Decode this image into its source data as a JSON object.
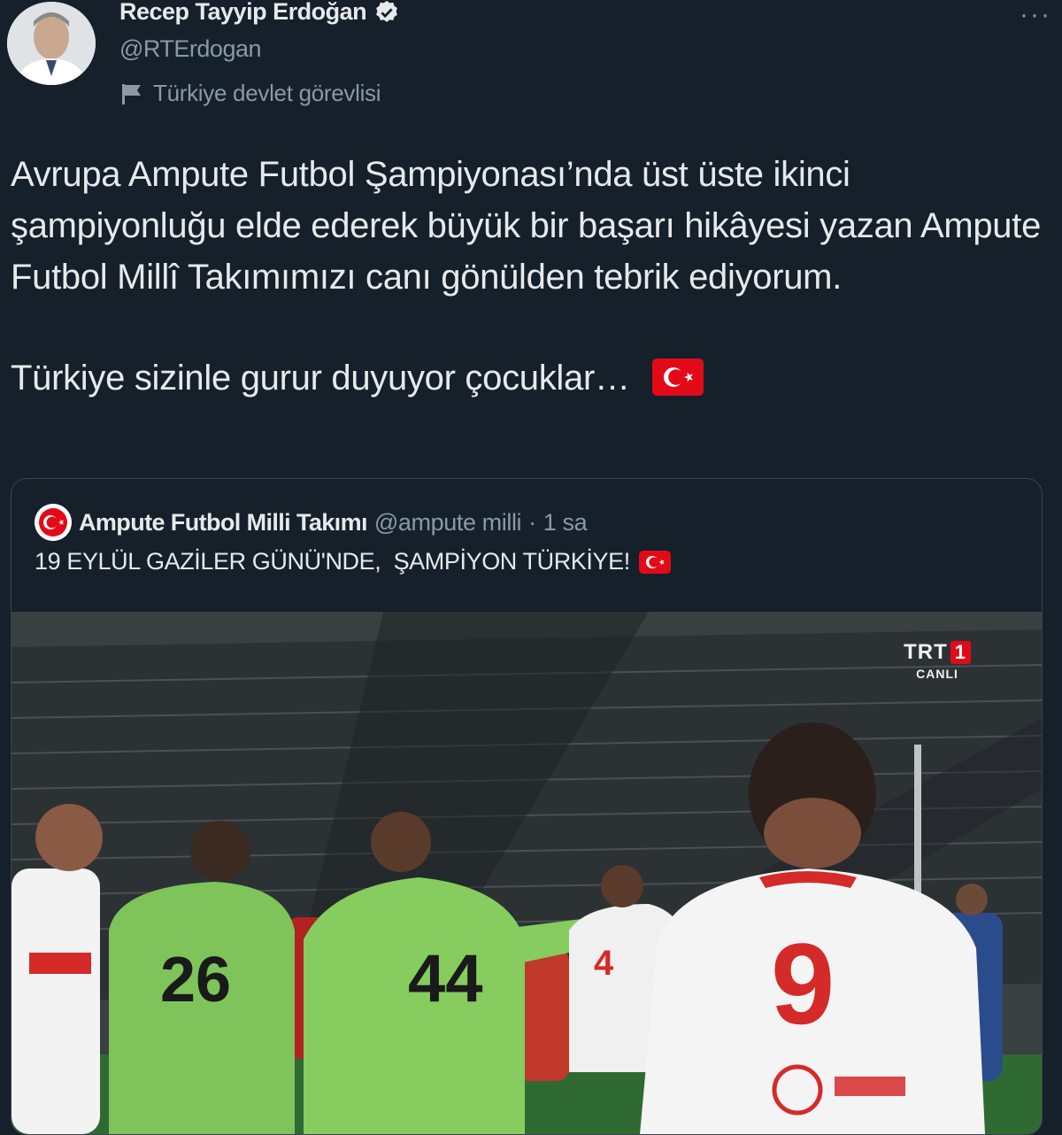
{
  "author": {
    "name": "Recep Tayyip Erdoğan",
    "handle": "@RTErdogan",
    "label": "Türkiye devlet görevlisi"
  },
  "tweet": {
    "paragraph1": "Avrupa Ampute Futbol Şampiyonası’nda üst üste ikinci şampiyonluğu elde ederek büyük bir başarı hikâyesi yazan Ampute Futbol Millî Takımımızı canı gönülden tebrik ediyorum.",
    "paragraph2": "Türkiye sizinle gurur duyuyor çocuklar…"
  },
  "quoted": {
    "name": "Ampute Futbol Milli Takımı",
    "handle": "@ampute milli",
    "separator": "·",
    "time": "1 sa",
    "text": "19 EYLÜL GAZİLER GÜNÜ'NDE,  ŞAMPİYON TÜRKİYE!"
  },
  "media": {
    "broadcaster": "TRT",
    "channel_number": "1",
    "live_label": "CANLI",
    "jerseys": [
      "26",
      "44",
      "9",
      "4"
    ]
  },
  "more_label": "···",
  "colors": {
    "background": "#15202b",
    "text": "#e7e9ea",
    "secondary": "#8b98a5",
    "flag_red": "#e30a17"
  }
}
